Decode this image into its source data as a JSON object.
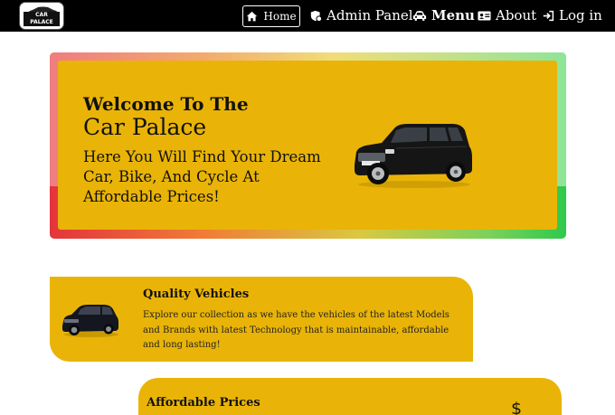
{
  "navbar": {
    "logo_text": "CAR PALACE",
    "home_label": "Home",
    "admin_label": "Admin Panel",
    "menu_label": "Menu",
    "about_label": "About",
    "login_label": "Log in",
    "icons": [
      "home-icon",
      "admin-shield-icon",
      "car-icon",
      "id-card-icon",
      "login-icon"
    ]
  },
  "hero": {
    "title_line1": "Welcome To The",
    "title_line2": "Car Palace",
    "subtitle": "Here You Will Find Your Dream Car, Bike, And Cycle At Affordable Prices!"
  },
  "features": [
    {
      "title": "Quality Vehicles",
      "text": "Explore our collection as we have the vehicles of the latest Models and Brands with latest Technology that is maintainable, affordable and long lasting!"
    },
    {
      "title": "Affordable Prices",
      "icon_glyph": "$"
    }
  ],
  "colors": {
    "accent": "#e9b407",
    "navbar_bg": "#000000",
    "text": "#111111"
  }
}
